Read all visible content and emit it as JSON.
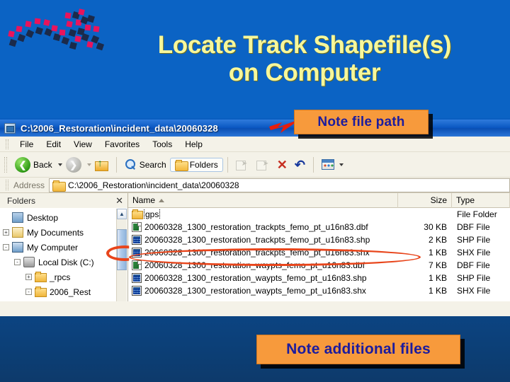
{
  "slide": {
    "title_line1": "Locate Track Shapefile(s)",
    "title_line2": "on Computer",
    "background_top": "#0b63c4",
    "background_bottom": "#0d3a6b",
    "title_color": "#f7f79a"
  },
  "annotations": {
    "path_callout": "Note file path",
    "files_callout": "Note additional files",
    "callout_bg": "#f79a3c",
    "callout_text_color": "#1c1c9e",
    "highlight_color": "#e8451b"
  },
  "explorer": {
    "titlebar": "C:\\2006_Restoration\\incident_data\\20060328",
    "menu": [
      "File",
      "Edit",
      "View",
      "Favorites",
      "Tools",
      "Help"
    ],
    "toolbar": {
      "back": "Back",
      "search": "Search",
      "folders": "Folders"
    },
    "address": {
      "label": "Address",
      "value": "C:\\2006_Restoration\\incident_data\\20060328"
    },
    "folders_pane": {
      "title": "Folders",
      "tree": [
        {
          "label": "Desktop",
          "indent": 0,
          "expander": "",
          "icon": "desktop"
        },
        {
          "label": "My Documents",
          "indent": 0,
          "expander": "+",
          "icon": "mydocs"
        },
        {
          "label": "My Computer",
          "indent": 0,
          "expander": "-",
          "icon": "mycomp"
        },
        {
          "label": "Local Disk (C:)",
          "indent": 1,
          "expander": "-",
          "icon": "disk"
        },
        {
          "label": "_rpcs",
          "indent": 2,
          "expander": "+",
          "icon": "folder"
        },
        {
          "label": "2006_Rest",
          "indent": 2,
          "expander": "-",
          "icon": "folder"
        }
      ]
    },
    "file_list": {
      "columns": [
        "Name",
        "Size",
        "Type"
      ],
      "rows": [
        {
          "name": "gps",
          "size": "",
          "type": "File Folder",
          "icon": "folder",
          "selected": true
        },
        {
          "name": "20060328_1300_restoration_trackpts_femo_pt_u16n83.dbf",
          "size": "30 KB",
          "type": "DBF File",
          "icon": "dbf",
          "selected": false
        },
        {
          "name": "20060328_1300_restoration_trackpts_femo_pt_u16n83.shp",
          "size": "2 KB",
          "type": "SHP File",
          "icon": "shp",
          "selected": false
        },
        {
          "name": "20060328_1300_restoration_trackpts_femo_pt_u16n83.shx",
          "size": "1 KB",
          "type": "SHX File",
          "icon": "shp",
          "selected": false
        },
        {
          "name": "20060328_1300_restoration_waypts_femo_pt_u16n83.dbf",
          "size": "7 KB",
          "type": "DBF File",
          "icon": "dbf",
          "selected": false
        },
        {
          "name": "20060328_1300_restoration_waypts_femo_pt_u16n83.shp",
          "size": "1 KB",
          "type": "SHP File",
          "icon": "shp",
          "selected": false
        },
        {
          "name": "20060328_1300_restoration_waypts_femo_pt_u16n83.shx",
          "size": "1 KB",
          "type": "SHX File",
          "icon": "shp",
          "selected": false
        }
      ]
    }
  }
}
